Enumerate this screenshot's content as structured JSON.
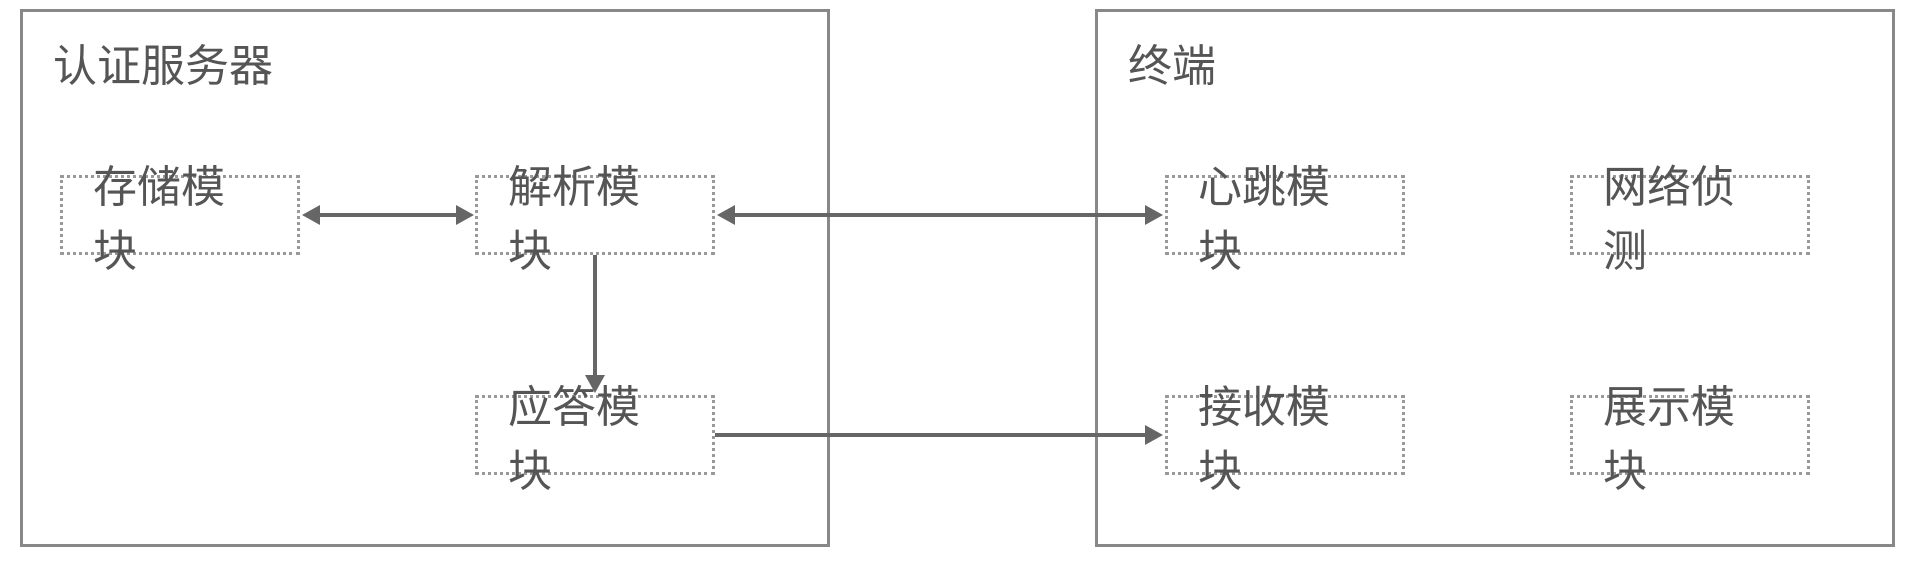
{
  "server": {
    "title": "认证服务器",
    "modules": {
      "storage": "存储模块",
      "parse": "解析模块",
      "response": "应答模块"
    }
  },
  "terminal": {
    "title": "终端",
    "modules": {
      "heartbeat": "心跳模块",
      "network": "网络侦测",
      "receive": "接收模块",
      "display": "展示模块"
    }
  }
}
